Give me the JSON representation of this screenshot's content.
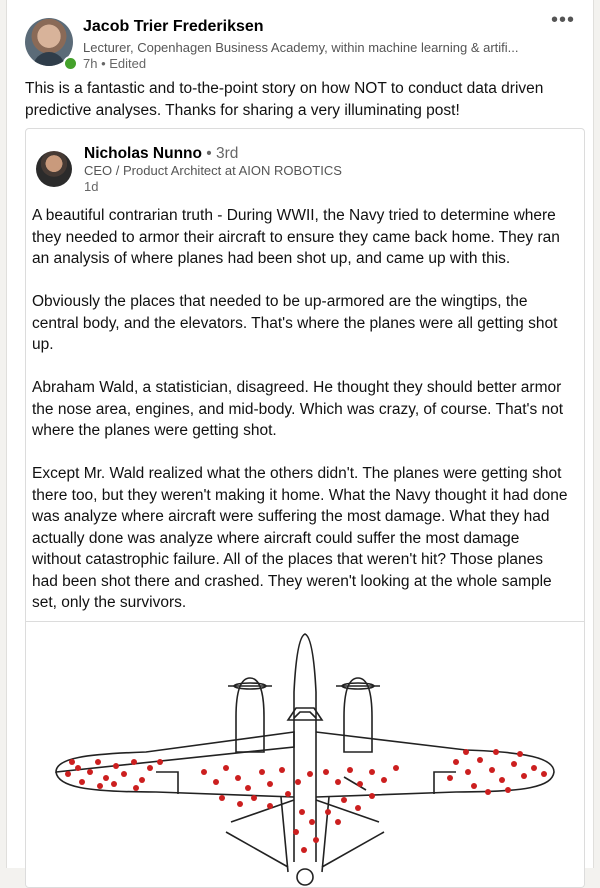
{
  "post": {
    "author_name": "Jacob Trier Frederiksen",
    "author_headline": "Lecturer, Copenhagen Business Academy, within machine learning & artifi...",
    "meta": "7h • Edited",
    "more_label": "•••",
    "commentary": "This is a fantastic and to-the-point story on how NOT to conduct data driven predictive analyses. Thanks for sharing a very illuminating post!"
  },
  "shared": {
    "author_name": "Nicholas Nunno",
    "degree": " • 3rd",
    "headline": "CEO / Product Architect at AION ROBOTICS",
    "time": "1d",
    "paragraphs": [
      "A beautiful contrarian truth - During WWII, the Navy tried to determine where they needed to armor their aircraft to ensure they came back home. They ran an analysis of where planes had been shot up, and came up with this.",
      "Obviously the places that needed to be up-armored are the wingtips, the central body, and the elevators. That's where the planes were all getting shot up.",
      "Abraham Wald, a statistician, disagreed. He thought they should better armor the nose area, engines, and mid-body. Which was crazy, of course. That's not where the planes were getting shot.",
      "Except Mr. Wald realized what the others didn't. The planes were getting shot there too, but they weren't making it home. What the Navy thought it had done was analyze where aircraft were suffering the most damage. What they had actually done was analyze where aircraft could suffer the most damage without catastrophic failure. All of the places that weren't hit? Those planes had been shot there and crashed. They weren't looking at the whole sample set, only the survivors."
    ]
  },
  "colors": {
    "presence": "#44a12b",
    "damage_dot": "#cc1f1f"
  }
}
